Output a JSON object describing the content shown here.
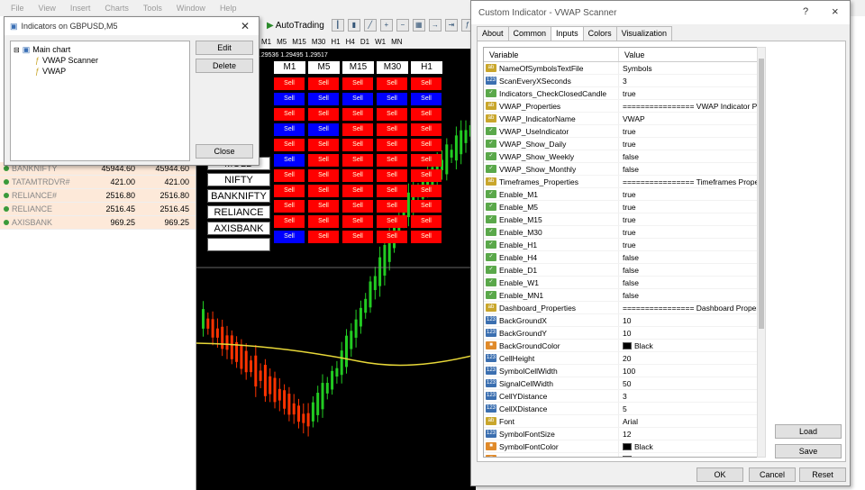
{
  "menubar": [
    "File",
    "View",
    "Insert",
    "Charts",
    "Tools",
    "Window",
    "Help"
  ],
  "toolbar": {
    "autotrading": "AutoTrading"
  },
  "timeframes": [
    "M1",
    "M5",
    "M15",
    "M30",
    "H1",
    "H4",
    "D1",
    "W1",
    "MN"
  ],
  "chart_header_text": "1.29536 1.29495 1.29517",
  "market_watch": [
    {
      "symbol": "BANKNIFTY",
      "bid": "45944.60",
      "ask": "45944.60",
      "bg": "#fde9d9"
    },
    {
      "symbol": "TATAMTRDVR#",
      "bid": "421.00",
      "ask": "421.00",
      "bg": "#fde9d9"
    },
    {
      "symbol": "RELIANCE#",
      "bid": "2516.80",
      "ask": "2516.80",
      "bg": "#fde9d9"
    },
    {
      "symbol": "RELIANCE",
      "bid": "2516.45",
      "ask": "2516.45",
      "bg": "#fde9d9"
    },
    {
      "symbol": "AXISBANK",
      "bid": "969.25",
      "ask": "969.25",
      "bg": "#fde9d9"
    }
  ],
  "dashboard": {
    "headers": [
      "M1",
      "M5",
      "M15",
      "M30",
      "H1"
    ],
    "symbols": [
      "MOLD",
      "NIFTY",
      "BANKNIFTY",
      "RELIANCE",
      "AXISBANK",
      ""
    ],
    "signal_label": "Sell",
    "colors": {
      "sell": "#ff0000",
      "buy": "#0000ff"
    },
    "rows": [
      [
        "red",
        "red",
        "red",
        "red",
        "red"
      ],
      [
        "blue",
        "blue",
        "blue",
        "blue",
        "blue"
      ],
      [
        "red",
        "red",
        "red",
        "red",
        "red"
      ],
      [
        "blue",
        "blue",
        "red",
        "red",
        "red"
      ],
      [
        "red",
        "red",
        "red",
        "red",
        "red"
      ],
      [
        "blue",
        "red",
        "red",
        "red",
        "red"
      ],
      [
        "red",
        "red",
        "red",
        "red",
        "red"
      ],
      [
        "red",
        "red",
        "red",
        "red",
        "red"
      ],
      [
        "red",
        "red",
        "red",
        "red",
        "red"
      ],
      [
        "red",
        "red",
        "red",
        "red",
        "red"
      ],
      [
        "blue",
        "red",
        "red",
        "red",
        "red"
      ]
    ]
  },
  "indicators_dialog": {
    "title": "Indicators on GBPUSD,M5",
    "tree": [
      "Main chart",
      "VWAP Scanner",
      "VWAP"
    ],
    "edit": "Edit",
    "delete": "Delete",
    "close": "Close"
  },
  "custom_dialog": {
    "title": "Custom Indicator - VWAP Scanner",
    "help": "?",
    "close_x": "×",
    "tabs": [
      "About",
      "Common",
      "Inputs",
      "Colors",
      "Visualization"
    ],
    "active_tab": "Inputs",
    "col_variable": "Variable",
    "col_value": "Value",
    "params": [
      {
        "t": "ab",
        "name": "NameOfSymbolsTextFile",
        "value": "Symbols"
      },
      {
        "t": "123",
        "name": "ScanEveryXSeconds",
        "value": "3"
      },
      {
        "t": "bool",
        "name": "Indicators_CheckClosedCandle",
        "value": "true"
      },
      {
        "t": "ab",
        "name": "VWAP_Properties",
        "value": "================ VWAP Indicator Prop..."
      },
      {
        "t": "ab",
        "name": "VWAP_IndicatorName",
        "value": "VWAP"
      },
      {
        "t": "bool",
        "name": "VWAP_UseIndicator",
        "value": "true"
      },
      {
        "t": "bool",
        "name": "VWAP_Show_Daily",
        "value": "true"
      },
      {
        "t": "bool",
        "name": "VWAP_Show_Weekly",
        "value": "false"
      },
      {
        "t": "bool",
        "name": "VWAP_Show_Monthly",
        "value": "false"
      },
      {
        "t": "ab",
        "name": "Timeframes_Properties",
        "value": "================ Timeframes Propertie..."
      },
      {
        "t": "bool",
        "name": "Enable_M1",
        "value": "true"
      },
      {
        "t": "bool",
        "name": "Enable_M5",
        "value": "true"
      },
      {
        "t": "bool",
        "name": "Enable_M15",
        "value": "true"
      },
      {
        "t": "bool",
        "name": "Enable_M30",
        "value": "true"
      },
      {
        "t": "bool",
        "name": "Enable_H1",
        "value": "true"
      },
      {
        "t": "bool",
        "name": "Enable_H4",
        "value": "false"
      },
      {
        "t": "bool",
        "name": "Enable_D1",
        "value": "false"
      },
      {
        "t": "bool",
        "name": "Enable_W1",
        "value": "false"
      },
      {
        "t": "bool",
        "name": "Enable_MN1",
        "value": "false"
      },
      {
        "t": "ab",
        "name": "Dashboard_Properties",
        "value": "================ Dashboard Properties..."
      },
      {
        "t": "123",
        "name": "BackGroundX",
        "value": "10"
      },
      {
        "t": "123",
        "name": "BackGroundY",
        "value": "10"
      },
      {
        "t": "clr",
        "name": "BackGroundColor",
        "value": "Black",
        "swatch": "#000000"
      },
      {
        "t": "123",
        "name": "CellHeight",
        "value": "20"
      },
      {
        "t": "123",
        "name": "SymbolCellWidth",
        "value": "100"
      },
      {
        "t": "123",
        "name": "SignalCellWidth",
        "value": "50"
      },
      {
        "t": "123",
        "name": "CellYDistance",
        "value": "3"
      },
      {
        "t": "123",
        "name": "CellXDistance",
        "value": "5"
      },
      {
        "t": "ab",
        "name": "Font",
        "value": "Arial"
      },
      {
        "t": "123",
        "name": "SymbolFontSize",
        "value": "12"
      },
      {
        "t": "clr",
        "name": "SymbolFontColor",
        "value": "Black",
        "swatch": "#000000"
      },
      {
        "t": "clr",
        "name": "SymbolCellColor",
        "value": "White",
        "swatch": "#ffffff"
      }
    ],
    "load": "Load",
    "save": "Save",
    "ok": "OK",
    "cancel": "Cancel",
    "reset": "Reset"
  }
}
